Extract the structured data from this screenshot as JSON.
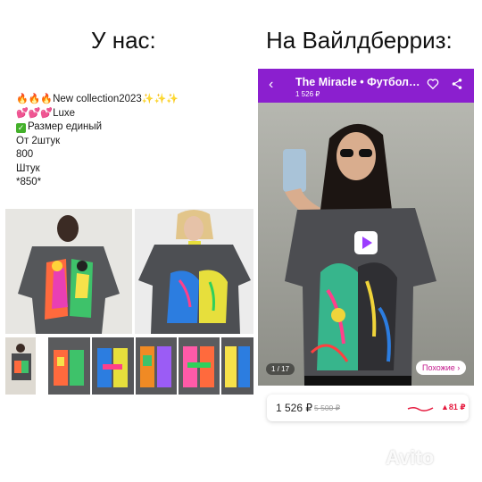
{
  "headings": {
    "left": "У нас:",
    "right": "На Вайлдберриз:"
  },
  "post": {
    "line1": "New collection2023",
    "line2": "Luxe",
    "line3": "Размер единый",
    "line4": "От 2штук",
    "line5": "800",
    "line6": "Штук",
    "line7": "*850*"
  },
  "app": {
    "title": "The Miracle • Футбол…",
    "header_price": "1 526 ₽",
    "image_counter": "1 / 17",
    "similar_button": "Похожие ›",
    "price": "1 526 ₽",
    "old_price": "5 500 ₽",
    "price_delta": "81 ₽"
  },
  "watermark": "Avito",
  "colors": {
    "app_bar": "#8b1fcf",
    "similar": "#c3198c",
    "delta": "#e5193d",
    "check": "#43b02a"
  },
  "icons": [
    "back-arrow-icon",
    "heart-icon",
    "share-icon",
    "play-icon",
    "trend-line-icon",
    "up-triangle-icon",
    "fire-icon",
    "sparkle-icon",
    "heart-emoji-icon",
    "check-icon"
  ]
}
